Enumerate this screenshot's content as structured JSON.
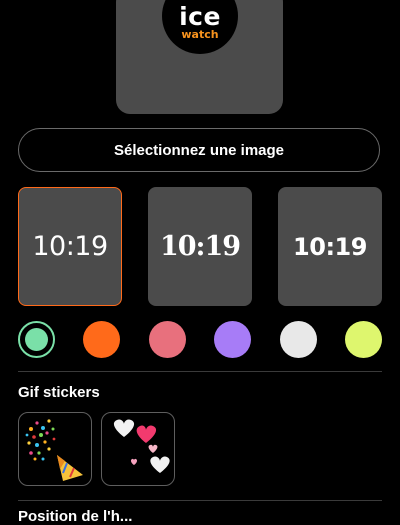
{
  "preview": {
    "logo_line1": "ice",
    "logo_line2": "watch"
  },
  "select_image_button": "Sélectionnez une image",
  "watch_faces": [
    {
      "time": "10:19",
      "selected": true
    },
    {
      "time": "10:19",
      "selected": false
    },
    {
      "time": "10:19",
      "selected": false
    }
  ],
  "colors": [
    {
      "name": "green",
      "hex": "#7ae0a8",
      "selected": true
    },
    {
      "name": "orange",
      "hex": "#ff6a1a",
      "selected": false
    },
    {
      "name": "pink",
      "hex": "#e8707d",
      "selected": false
    },
    {
      "name": "purple",
      "hex": "#a77cf7",
      "selected": false
    },
    {
      "name": "white",
      "hex": "#e8e8e8",
      "selected": false
    },
    {
      "name": "lime",
      "hex": "#def66e",
      "selected": false
    }
  ],
  "gif_stickers": {
    "title": "Gif stickers",
    "items": [
      {
        "icon": "party-popper-icon"
      },
      {
        "icon": "hearts-icon"
      }
    ]
  },
  "next_section_partial": "Position de l'h..."
}
